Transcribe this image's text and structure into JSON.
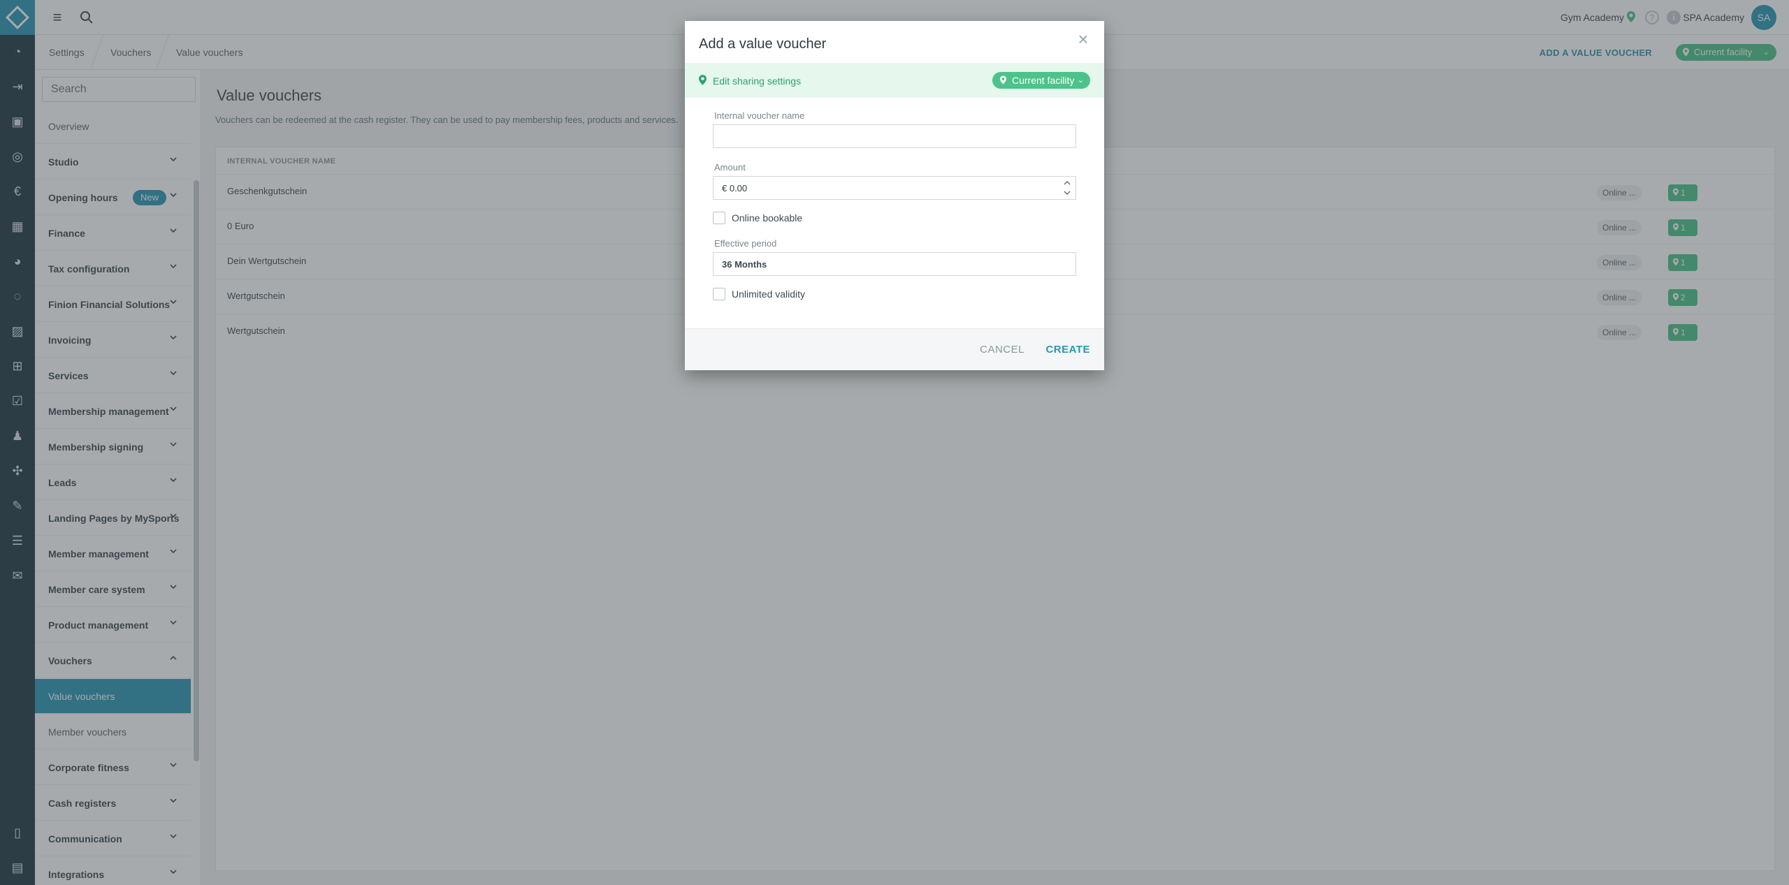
{
  "topbar": {
    "facility_name": "Gym Academy",
    "help_glyph": "?",
    "info_glyph": "i",
    "studio_name": "SPA Academy",
    "avatar_initials": "SA"
  },
  "breadcrumb": [
    "Settings",
    "Vouchers",
    "Value vouchers"
  ],
  "header_actions": {
    "add_voucher": "ADD A VALUE VOUCHER",
    "facility_filter": "Current facility"
  },
  "sidebar": {
    "search_placeholder": "Search",
    "items": [
      {
        "label": "Overview",
        "type": "sub"
      },
      {
        "label": "Studio",
        "type": "group"
      },
      {
        "label": "Opening hours",
        "type": "group",
        "badge": "New"
      },
      {
        "label": "Finance",
        "type": "group"
      },
      {
        "label": "Tax configuration",
        "type": "group"
      },
      {
        "label": "Finion Financial Solutions",
        "type": "group"
      },
      {
        "label": "Invoicing",
        "type": "group"
      },
      {
        "label": "Services",
        "type": "group"
      },
      {
        "label": "Membership management",
        "type": "group"
      },
      {
        "label": "Membership signing",
        "type": "group"
      },
      {
        "label": "Leads",
        "type": "group"
      },
      {
        "label": "Landing Pages by MySports",
        "type": "group"
      },
      {
        "label": "Member management",
        "type": "group"
      },
      {
        "label": "Member care system",
        "type": "group"
      },
      {
        "label": "Product management",
        "type": "group"
      },
      {
        "label": "Vouchers",
        "type": "group",
        "expanded": true
      },
      {
        "label": "Value vouchers",
        "type": "active"
      },
      {
        "label": "Member vouchers",
        "type": "sub"
      },
      {
        "label": "Corporate fitness",
        "type": "group"
      },
      {
        "label": "Cash registers",
        "type": "group"
      },
      {
        "label": "Communication",
        "type": "group"
      },
      {
        "label": "Integrations",
        "type": "group"
      }
    ]
  },
  "main": {
    "title": "Value vouchers",
    "description": "Vouchers can be redeemed at the cash register. They can be used to pay membership fees, products and services.",
    "column_header": "INTERNAL VOUCHER NAME",
    "rows": [
      {
        "name": "Geschenkgutschein",
        "online": "Online ...",
        "facilities": "1"
      },
      {
        "name": "0 Euro",
        "online": "Online ...",
        "facilities": "1"
      },
      {
        "name": "Dein Wertgutschein",
        "online": "Online ...",
        "facilities": "1"
      },
      {
        "name": "Wertgutschein",
        "online": "Online ...",
        "facilities": "2"
      },
      {
        "name": "Wertgutschein",
        "online": "Online ...",
        "facilities": "1"
      }
    ]
  },
  "dialog": {
    "title": "Add a value voucher",
    "sharing_label": "Edit sharing settings",
    "sharing_scope": "Current facility",
    "name_label": "Internal voucher name",
    "name_value": "",
    "amount_label": "Amount",
    "amount_value": "€ 0.00",
    "online_bookable_label": "Online bookable",
    "online_bookable_checked": false,
    "period_label": "Effective period",
    "period_value": "36 Months",
    "unlimited_label": "Unlimited validity",
    "unlimited_checked": false,
    "cancel_label": "CANCEL",
    "create_label": "CREATE"
  },
  "colors": {
    "accent": "#2a96b6",
    "success": "#4cc38a",
    "rail": "#1f3a45"
  }
}
